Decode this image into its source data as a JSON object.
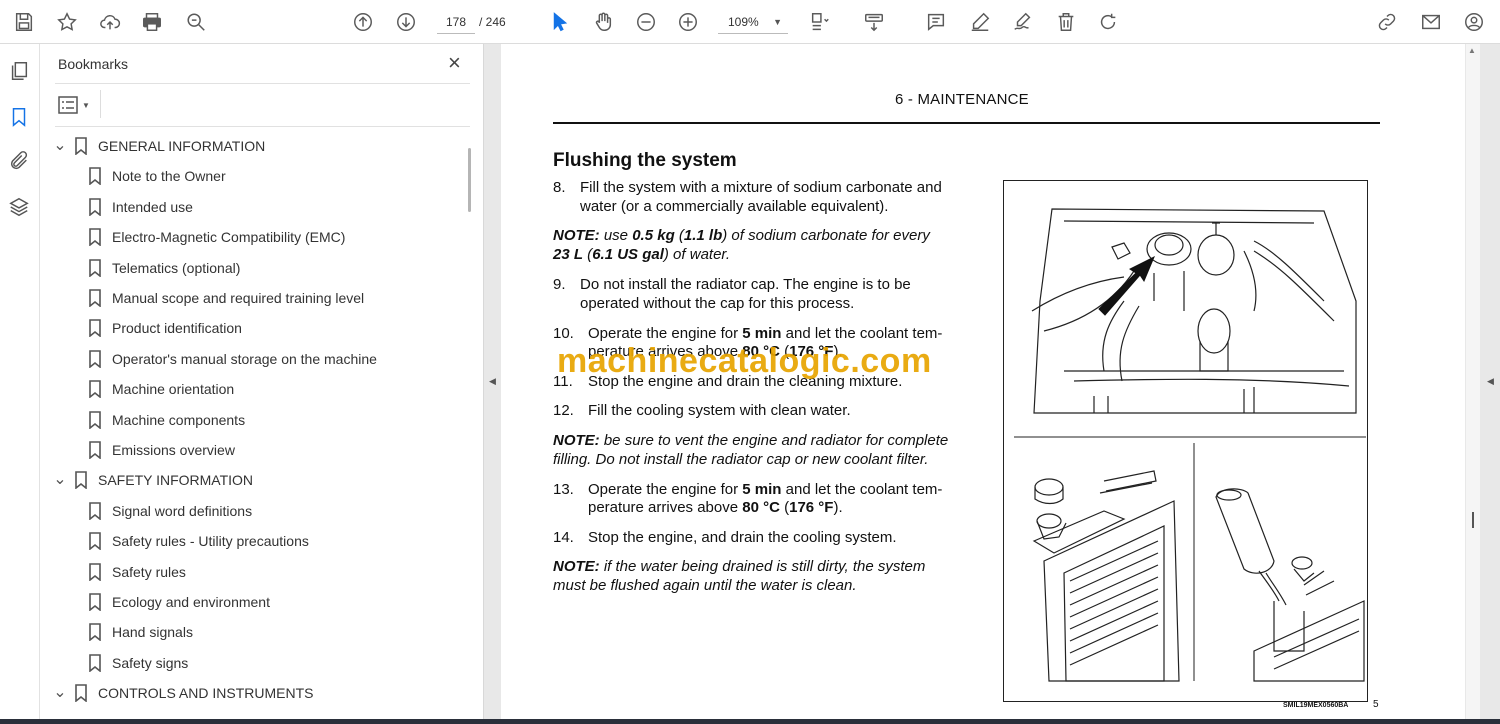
{
  "toolbar": {
    "current_page": "178",
    "total_pages": "/ 246",
    "zoom": "109%"
  },
  "bookmarks": {
    "title": "Bookmarks",
    "close_glyph": "×",
    "items": [
      {
        "label": "GENERAL INFORMATION",
        "level": 0
      },
      {
        "label": "Note to the Owner",
        "level": 1
      },
      {
        "label": "Intended use",
        "level": 1
      },
      {
        "label": "Electro-Magnetic Compatibility (EMC)",
        "level": 1
      },
      {
        "label": "Telematics (optional)",
        "level": 1
      },
      {
        "label": "Manual scope and required training level",
        "level": 1
      },
      {
        "label": "Product identification",
        "level": 1
      },
      {
        "label": "Operator's manual storage on the machine",
        "level": 1
      },
      {
        "label": "Machine orientation",
        "level": 1
      },
      {
        "label": "Machine components",
        "level": 1
      },
      {
        "label": "Emissions overview",
        "level": 1
      },
      {
        "label": "SAFETY INFORMATION",
        "level": 0
      },
      {
        "label": "Signal word definitions",
        "level": 1
      },
      {
        "label": "Safety rules - Utility precautions",
        "level": 1
      },
      {
        "label": "Safety rules",
        "level": 1
      },
      {
        "label": "Ecology and environment",
        "level": 1
      },
      {
        "label": "Hand signals",
        "level": 1
      },
      {
        "label": "Safety signs",
        "level": 1
      },
      {
        "label": "CONTROLS AND INSTRUMENTS",
        "level": 0
      }
    ]
  },
  "document": {
    "header": "6 - MAINTENANCE",
    "section_title": "Flushing the system",
    "step8_num": "8.",
    "step8_l1": "Fill the system with a mixture of sodium carbonate and",
    "step8_l2": "water (or a commercially available equivalent).",
    "note1_l1_a": "NOTE:",
    "note1_l1_b": " use ",
    "note1_l1_c": "0.5 kg",
    "note1_l1_d": " (",
    "note1_l1_e": "1.1 lb",
    "note1_l1_f": ") of sodium carbonate for every",
    "note1_l2_a": "23 L",
    "note1_l2_b": " (",
    "note1_l2_c": "6.1 US gal",
    "note1_l2_d": ") of water.",
    "step9_num": "9.",
    "step9_l1": "Do not install the radiator cap.  The engine is to be",
    "step9_l2": "operated without the cap for this process.",
    "step10_num": "10.",
    "step10_l1_a": "Operate the engine for ",
    "step10_l1_b": "5 min",
    "step10_l1_c": " and let the coolant tem-",
    "step10_l2_a": "perature arrives above ",
    "step10_l2_b": "80 °C",
    "step10_l2_c": " (",
    "step10_l2_d": "176 °F",
    "step10_l2_e": ").",
    "step11_num": "11.",
    "step11_l1": "Stop the engine and drain the cleaning mixture.",
    "step12_num": "12.",
    "step12_l1": "Fill the cooling system with clean water.",
    "note2_a": "NOTE:",
    "note2_l1": " be sure to vent the engine and radiator for complete",
    "note2_l2": "filling.  Do not install the radiator cap or new coolant filter.",
    "step13_num": "13.",
    "step13_l1_a": "Operate the engine for ",
    "step13_l1_b": "5 min",
    "step13_l1_c": " and let the coolant tem-",
    "step13_l2_a": "perature arrives above ",
    "step13_l2_b": "80 °C",
    "step13_l2_c": " (",
    "step13_l2_d": "176 °F",
    "step13_l2_e": ").",
    "step14_num": "14.",
    "step14_l1": "Stop the engine, and drain the cooling system.",
    "note3_a": "NOTE:",
    "note3_l1": " if the water being drained is still dirty, the system",
    "note3_l2": "must be flushed again until the water is clean.",
    "watermark": "machinecatalogic.com",
    "figure_code": "SMIL19MEX0560BA",
    "page_number": "5"
  }
}
